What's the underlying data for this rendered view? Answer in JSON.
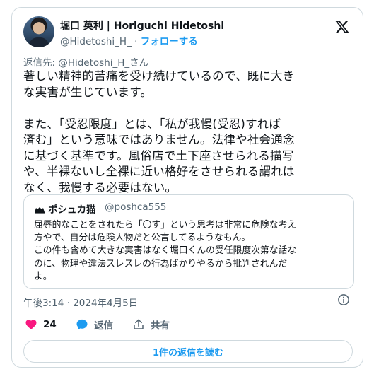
{
  "author": {
    "display_name": "堀口 英利 | Horiguchi Hidetoshi",
    "handle": "@Hidetoshi_H_",
    "separator": " · ",
    "follow_label": "フォローする"
  },
  "reply_to": "返信先: @Hidetoshi_H_さん",
  "tweet": {
    "lines": [
      "著しい精神的苦痛を受け続けているので、既に大き",
      "な実害が生じています。",
      "",
      "また、「受忍限度」とは、「私が我慢(受忍)すれば",
      "済む」という意味ではありません。法律や社会通念",
      "に基づく基準です。風俗店で土下座させられる描写",
      "や、半裸ないし全裸に近い格好をさせられる謂れは",
      "なく、我慢する必要はない。"
    ]
  },
  "quote": {
    "name": "ポシュカ猫",
    "handle": "@poshca555",
    "lines": [
      "屈辱的なことをされたら「〇す」という思考は非常に危険な考え",
      "方やで、自分は危険人物だと公言してるようなもん。",
      "この件も含めて大きな実害はなく堀口くんの受任限度次第な話な",
      "のに、物理や違法スレスレの行為ばかりやるから批判されんだ",
      "よ。"
    ]
  },
  "timestamp": "午後3:14 · 2024年4月5日",
  "actions": {
    "like_count": "24",
    "reply_label": "返信",
    "share_label": "共有"
  },
  "read_replies_label": "1件の返信を読む",
  "colors": {
    "accent": "#1d9bf0",
    "like": "#f91880",
    "muted": "#536471",
    "border": "#cfd9de"
  },
  "icons": {
    "x_logo": "x-logo-icon",
    "info": "info-icon",
    "like": "heart-icon",
    "reply": "speech-bubble-icon",
    "share": "share-upload-icon"
  }
}
